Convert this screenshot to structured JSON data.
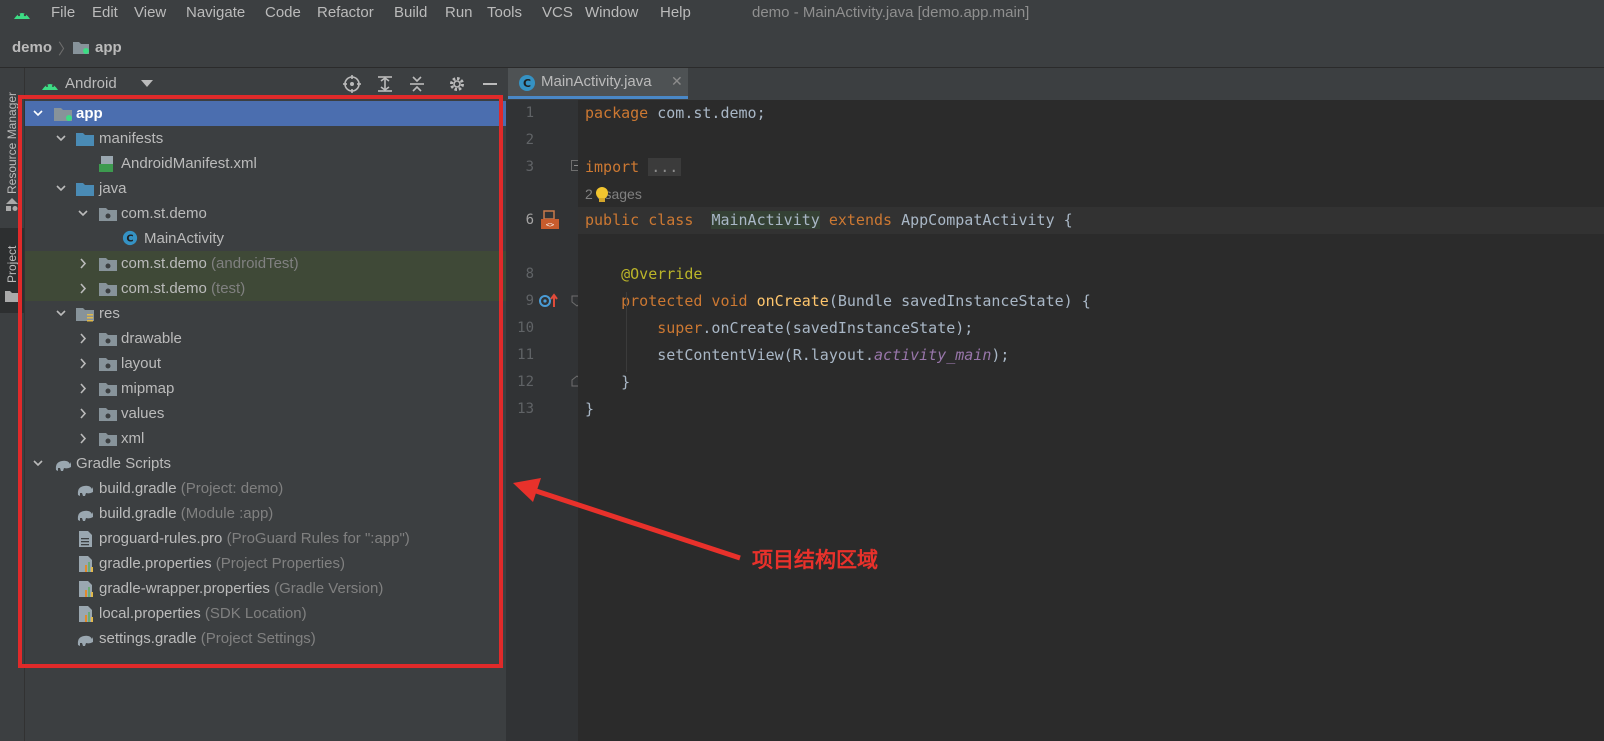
{
  "menubar": {
    "items": [
      "File",
      "Edit",
      "View",
      "Navigate",
      "Code",
      "Refactor",
      "Build",
      "Run",
      "Tools",
      "VCS",
      "Window",
      "Help"
    ],
    "window_title": "demo - MainActivity.java [demo.app.main]"
  },
  "breadcrumb": {
    "project": "demo",
    "module": "app"
  },
  "side_tabs": {
    "resource_manager": "Resource Manager",
    "project": "Project"
  },
  "project_panel": {
    "view_selector": "Android",
    "tree": [
      {
        "label": "app",
        "hint": "",
        "icon": "module-folder-icon"
      },
      {
        "label": "manifests",
        "hint": "",
        "icon": "folder-icon"
      },
      {
        "label": "AndroidManifest.xml",
        "hint": "",
        "icon": "manifest-file-icon"
      },
      {
        "label": "java",
        "hint": "",
        "icon": "folder-icon"
      },
      {
        "label": "com.st.demo",
        "hint": "",
        "icon": "package-icon"
      },
      {
        "label": "MainActivity",
        "hint": "",
        "icon": "class-icon"
      },
      {
        "label": "com.st.demo",
        "hint": "(androidTest)",
        "icon": "package-icon"
      },
      {
        "label": "com.st.demo",
        "hint": "(test)",
        "icon": "package-icon"
      },
      {
        "label": "res",
        "hint": "",
        "icon": "resource-folder-icon"
      },
      {
        "label": "drawable",
        "hint": "",
        "icon": "package-icon"
      },
      {
        "label": "layout",
        "hint": "",
        "icon": "package-icon"
      },
      {
        "label": "mipmap",
        "hint": "",
        "icon": "package-icon"
      },
      {
        "label": "values",
        "hint": "",
        "icon": "package-icon"
      },
      {
        "label": "xml",
        "hint": "",
        "icon": "package-icon"
      },
      {
        "label": "Gradle Scripts",
        "hint": "",
        "icon": "gradle-icon"
      },
      {
        "label": "build.gradle",
        "hint": "(Project: demo)",
        "icon": "gradle-icon"
      },
      {
        "label": "build.gradle",
        "hint": "(Module :app)",
        "icon": "gradle-icon"
      },
      {
        "label": "proguard-rules.pro",
        "hint": "(ProGuard Rules for \":app\")",
        "icon": "text-file-icon"
      },
      {
        "label": "gradle.properties",
        "hint": "(Project Properties)",
        "icon": "properties-file-icon"
      },
      {
        "label": "gradle-wrapper.properties",
        "hint": "(Gradle Version)",
        "icon": "properties-file-icon"
      },
      {
        "label": "local.properties",
        "hint": "(SDK Location)",
        "icon": "properties-file-icon"
      },
      {
        "label": "settings.gradle",
        "hint": "(Project Settings)",
        "icon": "gradle-icon"
      }
    ]
  },
  "editor": {
    "tab_label": "MainActivity.java",
    "line_numbers": [
      "1",
      "2",
      "3",
      "6",
      "8",
      "9",
      "10",
      "11",
      "12",
      "13"
    ],
    "usages": "2 usages",
    "code": {
      "l1_kw": "package",
      "l1_rest": " com.st.demo;",
      "l3_kw": "import",
      "l3_fold": "...",
      "l6_kw": "public class",
      "l6_cls": "MainActivity",
      "l6_ext": "extends",
      "l6_rest": " AppCompatActivity {",
      "l8_ann": "@Override",
      "l9_kw": "protected void",
      "l9_fn": "onCreate",
      "l9_rest": "(Bundle savedInstanceState) {",
      "l10_kw": "super",
      "l10_rest": ".onCreate(savedInstanceState);",
      "l11_pre": "setContentView(R.layout.",
      "l11_it": "activity_main",
      "l11_post": ");",
      "l12": "}",
      "l13": "}"
    }
  },
  "annotation": {
    "label": "项目结构区域",
    "color": "#e8312b"
  }
}
